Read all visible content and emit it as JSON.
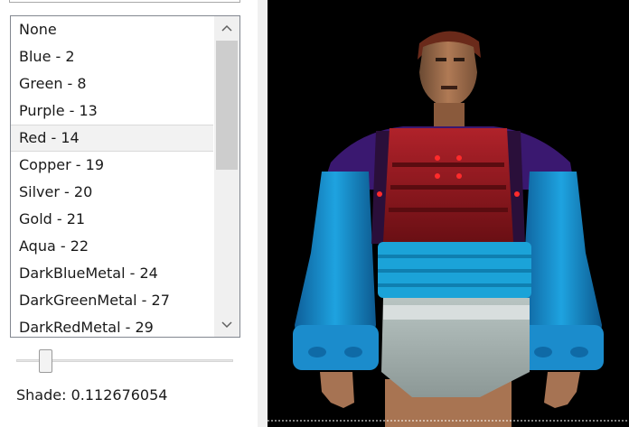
{
  "list": {
    "items": [
      "None",
      "Blue - 2",
      "Green - 8",
      "Purple - 13",
      "Red - 14",
      "Copper - 19",
      "Silver - 20",
      "Gold - 21",
      "Aqua - 22",
      "DarkBlueMetal - 24",
      "DarkGreenMetal - 27",
      "DarkRedMetal - 29"
    ],
    "selected": "Red - 14"
  },
  "shade": {
    "label": "Shade: 0.112676054",
    "value": 0.112676054
  },
  "colors": {
    "viewport_bg": "#000000",
    "selection_bg": "#f2f2f2"
  },
  "icons": {
    "scroll_up": "chevron-up-icon",
    "scroll_down": "chevron-down-icon"
  }
}
